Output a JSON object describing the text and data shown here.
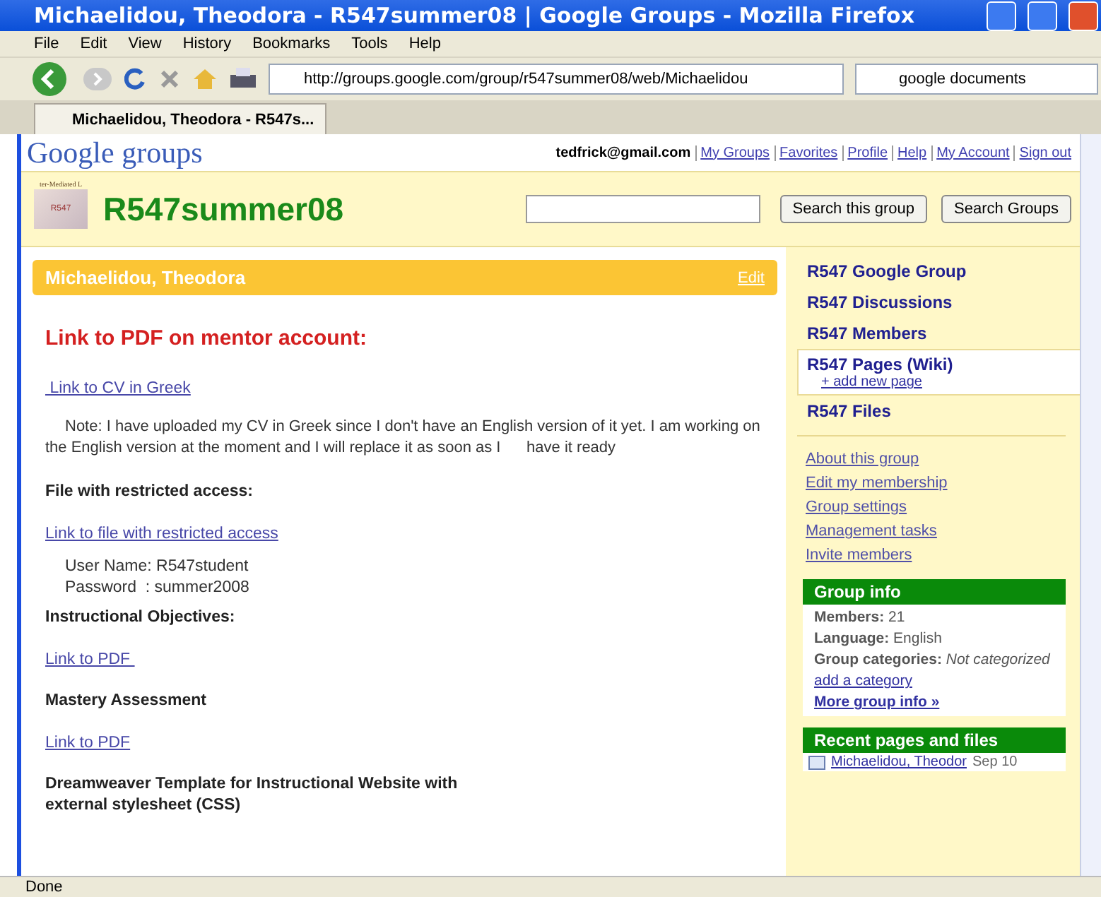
{
  "window": {
    "title": "Michaelidou, Theodora - R547summer08 | Google Groups - Mozilla Firefox"
  },
  "menu": [
    "File",
    "Edit",
    "View",
    "History",
    "Bookmarks",
    "Tools",
    "Help"
  ],
  "address": {
    "value": "http://groups.google.com/group/r547summer08/web/Michaelidou"
  },
  "search_engine": {
    "value": "google documents"
  },
  "tabs": [
    {
      "label": "Michaelidou, Theodora - R547s...",
      "selected": true
    }
  ],
  "header": {
    "logo_word": "Google",
    "logo_product": "groups",
    "account": "tedfrick@gmail.com",
    "links": [
      "My Groups",
      "Favorites",
      "Profile",
      "Help",
      "My Account",
      "Sign out"
    ]
  },
  "group": {
    "badge_caption": "ter-Mediated L",
    "badge_label": "R547",
    "name": "R547summer08",
    "buttons": [
      "Search this group",
      "Search Groups"
    ]
  },
  "page": {
    "title": "Michaelidou, Theodora",
    "edit": "Edit",
    "blocks": [
      {
        "kind": "heading",
        "text": "Link to PDF on mentor account:"
      },
      {
        "kind": "link",
        "text": " Link to CV in Greek"
      },
      {
        "kind": "para",
        "text": "Note: I have uploaded my CV in Greek since I don't have an English version of it yet. I am working on the English version at the moment and I will replace it as soon as I      have it ready"
      },
      {
        "kind": "bold",
        "text": "File with restricted access:"
      },
      {
        "kind": "link",
        "text": "Link to file with restricted access"
      },
      {
        "kind": "indent",
        "text": "User Name: R547student"
      },
      {
        "kind": "indent",
        "text": "Password  : summer2008"
      },
      {
        "kind": "bold",
        "text": "Instructional Objectives:"
      },
      {
        "kind": "link",
        "text": "Link to PDF "
      },
      {
        "kind": "bold",
        "text": "Mastery Assessment"
      },
      {
        "kind": "link",
        "text": "Link to PDF"
      },
      {
        "kind": "bold",
        "text": "Dreamweaver Template  for Instructional Website with external stylesheet (CSS)"
      }
    ]
  },
  "sidebar": {
    "nav": [
      {
        "label": "R547 Google Group",
        "selected": false
      },
      {
        "label": "R547 Discussions",
        "selected": false
      },
      {
        "label": "R547 Members",
        "selected": false
      },
      {
        "label": "R547 Pages (Wiki)",
        "selected": true,
        "sub": "+ add new page"
      },
      {
        "label": "R547 Files",
        "selected": false
      }
    ],
    "links": [
      "About this group",
      "Edit my membership",
      "Group settings",
      "Management tasks",
      "Invite members"
    ],
    "info": {
      "title": "Group info",
      "rows": [
        {
          "key": "Members:",
          "value": "21",
          "italic": false
        },
        {
          "key": "Language:",
          "value": "English",
          "italic": false
        },
        {
          "key": "Group categories:",
          "value": "Not categorized",
          "italic": true
        }
      ],
      "add": "add a category",
      "more": "More group info »"
    },
    "recent": {
      "title": "Recent pages and files",
      "items": [
        {
          "name": "Michaelidou, Theodor",
          "date": "Sep 10"
        }
      ]
    }
  },
  "status_bar": "Done"
}
